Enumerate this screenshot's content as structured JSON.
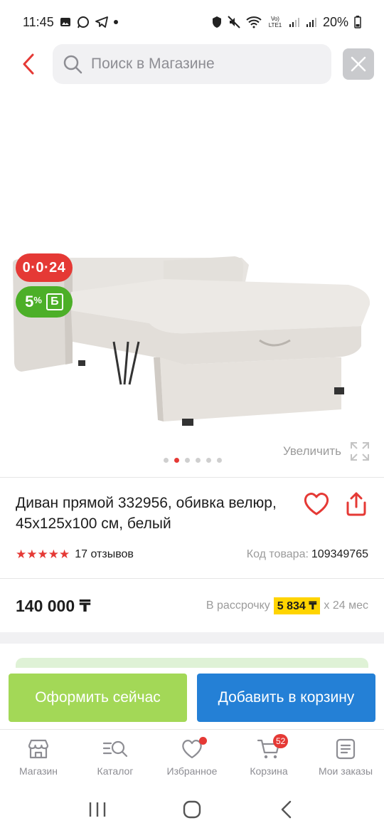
{
  "status_bar": {
    "time": "11:45",
    "battery": "20%",
    "network_label": "Vo) LTE1"
  },
  "search": {
    "placeholder": "Поиск в Магазине",
    "back_icon": "chevron-left-icon",
    "close_icon": "close-icon"
  },
  "gallery": {
    "installment_badge": "0·0·24",
    "bonus_percent": "5",
    "bonus_percent_sign": "%",
    "bonus_symbol": "Б",
    "zoom_label": "Увеличить",
    "dots_total": 6,
    "active_dot": 2
  },
  "product": {
    "title": "Диван прямой 332956, обивка велюр, 45x125x100 см, белый",
    "rating_stars": 5,
    "reviews": "17 отзывов",
    "sku_label": "Код товара:",
    "sku_value": "109349765",
    "price": "140 000 ₸",
    "installment_prefix": "В рассрочку",
    "installment_amount": "5 834 ₸",
    "installment_suffix": "х 24 мес"
  },
  "actions": {
    "checkout_label": "Оформить сейчас",
    "cart_label": "Добавить в корзину"
  },
  "bottom_nav": {
    "items": [
      {
        "label": "Магазин",
        "icon": "store-icon"
      },
      {
        "label": "Каталог",
        "icon": "catalog-search-icon"
      },
      {
        "label": "Избранное",
        "icon": "heart-icon"
      },
      {
        "label": "Корзина",
        "icon": "cart-icon",
        "badge": "52"
      },
      {
        "label": "Мои заказы",
        "icon": "orders-icon"
      }
    ]
  },
  "colors": {
    "accent_red": "#e53935",
    "bonus_green": "#4caf28",
    "checkout_green": "#a3d857",
    "cart_blue": "#2480d6",
    "installment_yellow": "#ffd400"
  }
}
